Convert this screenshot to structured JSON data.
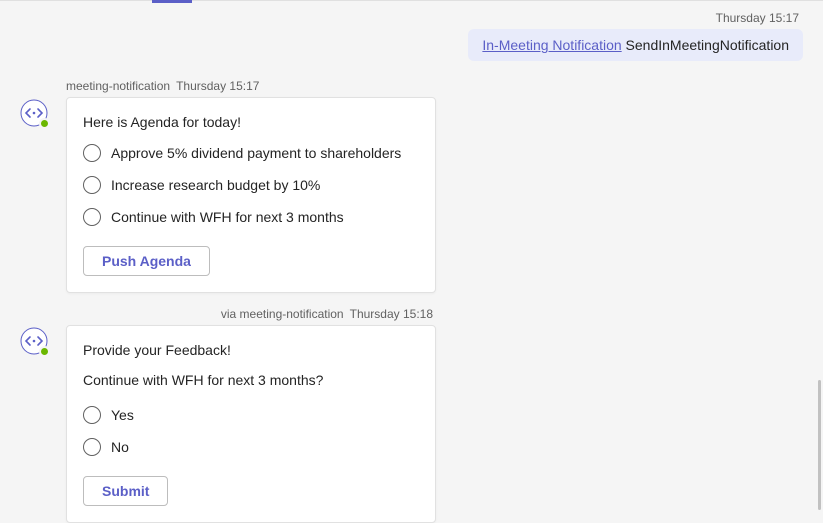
{
  "topTimestamp": "Thursday 15:17",
  "userMessage": {
    "linkText": "In-Meeting Notification",
    "commandText": " SendInMeetingNotification"
  },
  "botCards": [
    {
      "header": {
        "sender": "meeting-notification",
        "time": "Thursday 15:17",
        "via": ""
      },
      "type": "agenda",
      "title": "Here is Agenda for today!",
      "options": [
        "Approve 5% dividend payment to shareholders",
        "Increase research budget by 10%",
        "Continue with WFH for next 3 months"
      ],
      "button": "Push Agenda"
    },
    {
      "header": {
        "via": "via meeting-notification",
        "time": "Thursday 15:18",
        "sender": ""
      },
      "type": "feedback",
      "title": "Provide your Feedback!",
      "subtitle": "Continue with WFH for next 3 months?",
      "options": [
        "Yes",
        "No"
      ],
      "button": "Submit"
    }
  ]
}
